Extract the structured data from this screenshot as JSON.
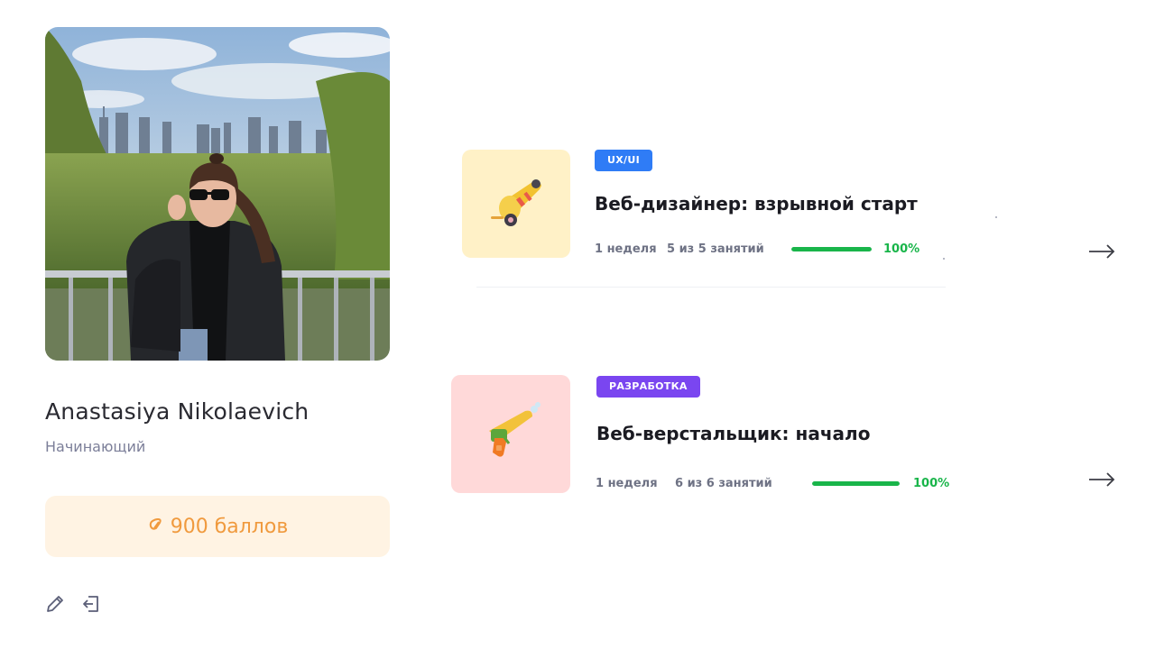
{
  "profile": {
    "name": "Anastasiya Nikolaevich",
    "level": "Начинающий",
    "points_label": "900 баллов",
    "points_icon": "coin-icon"
  },
  "actions": [
    {
      "icon": "pencil-icon"
    },
    {
      "icon": "logout-icon"
    }
  ],
  "courses": [
    {
      "tag": "UX/UI",
      "tag_color": "#2f7cf6",
      "title": "Веб-дизайнер: взрывной старт",
      "duration": "1 неделя",
      "lessons": "5 из 5 занятий",
      "progress": 1.0,
      "progress_label": "100%",
      "thumb_bg": "#fff1c7",
      "thumb_icon": "cannon-icon"
    },
    {
      "tag": "РАЗРАБОТКА",
      "tag_color": "#7a46f0",
      "title": "Веб-верстальщик: начало",
      "duration": "1 неделя",
      "lessons": "6 из 6 занятий",
      "progress": 1.0,
      "progress_label": "100%",
      "thumb_bg": "#ffd9d9",
      "thumb_icon": "water-gun-icon"
    }
  ]
}
